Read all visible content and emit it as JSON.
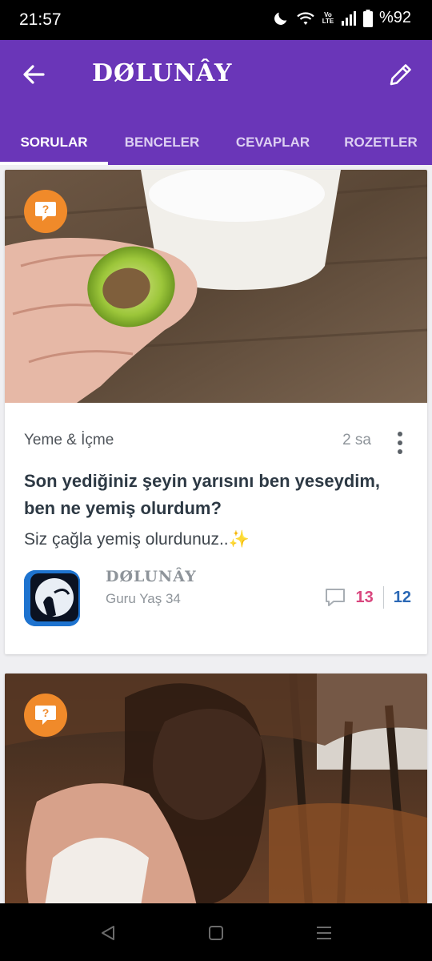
{
  "status_bar": {
    "time": "21:57",
    "network_label": "Vo LTE",
    "battery": "%92"
  },
  "app_bar": {
    "title": "DØLUNÂY"
  },
  "tabs": [
    {
      "label": "SORULAR",
      "active": true
    },
    {
      "label": "BENCELER",
      "active": false
    },
    {
      "label": "CEVAPLAR",
      "active": false
    },
    {
      "label": "ROZETLER",
      "active": false
    }
  ],
  "questions": [
    {
      "category": "Yeme & İçme",
      "time_ago": "2 sa",
      "title": "Son yediğiniz şeyin yarısını ben yeseydim, ben ne yemiş olurdum?",
      "body": "Siz çağla yemiş olurdunuz..✨",
      "author": {
        "name": "DØLUNÂY",
        "level": "Guru",
        "age": "Yaş 34"
      },
      "answer_count": "13",
      "like_count": "12"
    }
  ],
  "colors": {
    "primary": "#6a36b8",
    "badge": "#f08a2a",
    "answers": "#d9467e",
    "likes": "#2b68b5"
  },
  "icons": {
    "question_badge": "question-bubble-icon",
    "comment": "comment-icon",
    "more": "more-vertical-icon",
    "back": "arrow-left-icon",
    "edit": "pencil-icon"
  }
}
